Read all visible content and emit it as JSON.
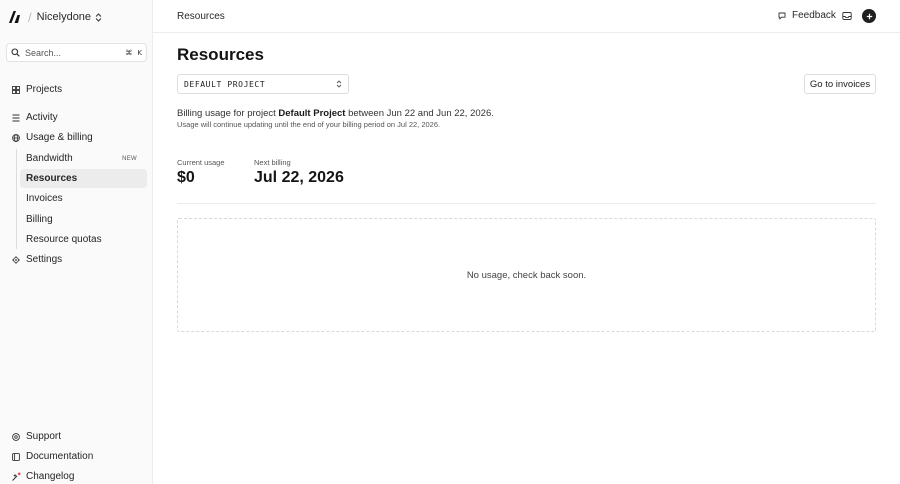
{
  "sidebar": {
    "team_name": "Nicelydone",
    "search": {
      "placeholder": "Search...",
      "shortcut_cmd": "⌘",
      "shortcut_key": "K"
    },
    "nav": {
      "projects": "Projects",
      "activity": "Activity",
      "usage_billing": "Usage & billing",
      "settings": "Settings"
    },
    "sub_items": {
      "bandwidth": "Bandwidth",
      "bandwidth_badge": "NEW",
      "resources": "Resources",
      "invoices": "Invoices",
      "billing": "Billing",
      "resource_quotas": "Resource quotas"
    },
    "footer": {
      "support": "Support",
      "documentation": "Documentation",
      "changelog": "Changelog"
    }
  },
  "header": {
    "breadcrumb": "Resources",
    "feedback_label": "Feedback"
  },
  "main": {
    "title": "Resources",
    "project_select": {
      "value": "DEFAULT PROJECT"
    },
    "go_to_invoices": "Go to invoices",
    "description": {
      "prefix": "Billing usage for project ",
      "project_name": "Default Project",
      "suffix": " between Jun 22 and Jun 22, 2026.",
      "note": "Usage will continue updating until the end of your billing period on Jul 22, 2026."
    },
    "current_usage": {
      "label": "Current usage",
      "value": "$0"
    },
    "next_billing": {
      "label": "Next billing",
      "value": "Jul 22, 2026"
    },
    "empty_state": "No usage, check back soon."
  },
  "colors": {
    "sidebar_bg": "#fafafa",
    "active_item_bg": "#ececec",
    "text_primary": "#141414",
    "notification_dot": "#e5484d"
  },
  "icons": {
    "logo": "app-logo-icon",
    "team_switch": "chevron-up-down-icon",
    "search": "search-icon",
    "projects": "grid-icon",
    "activity": "list-icon",
    "usage_billing": "globe-icon",
    "settings": "gear-icon",
    "support": "help-circle-icon",
    "documentation": "book-icon",
    "changelog": "sparkle-icon",
    "feedback": "speech-bubble-icon",
    "inbox": "inbox-icon",
    "create": "plus-icon",
    "select": "chevron-up-down-icon"
  }
}
